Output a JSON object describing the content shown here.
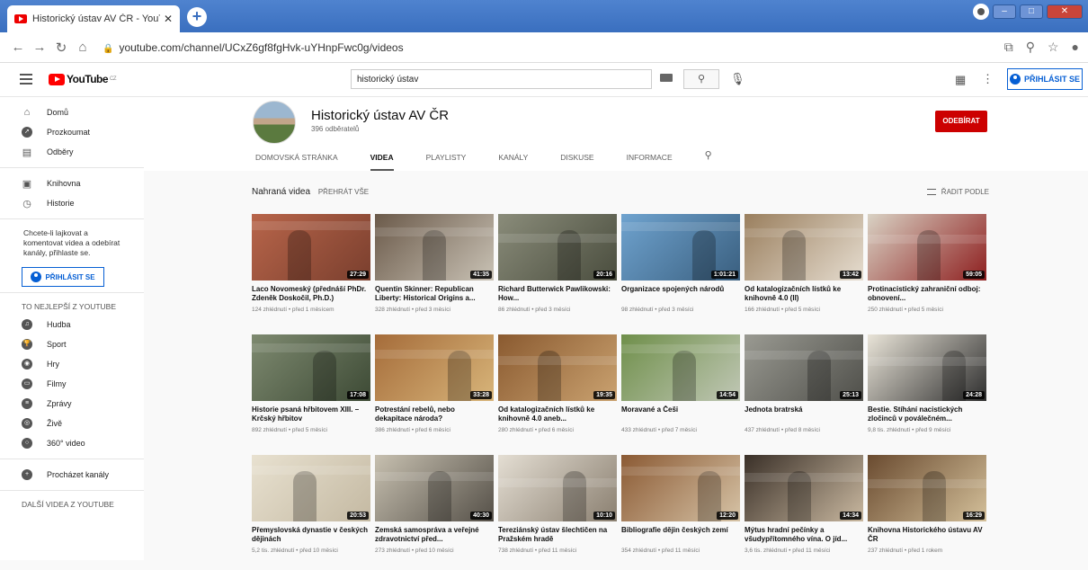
{
  "browser": {
    "tab_title": "Historický ústav AV ČR - YouTube",
    "tab_close": "✕",
    "new_tab": "+",
    "url": "youtube.com/channel/UCxZ6gf8fgHvk-uYHnpFwc0g/videos"
  },
  "header": {
    "logo_text": "YouTube",
    "logo_sup": "CZ",
    "search_value": "historický ústav",
    "signin_label": "PŘIHLÁSIT SE"
  },
  "sidebar": {
    "nav": [
      {
        "label": "Domů",
        "icon": "home-icon"
      },
      {
        "label": "Prozkoumat",
        "icon": "compass-icon"
      },
      {
        "label": "Odběry",
        "icon": "subscriptions-icon"
      }
    ],
    "library": [
      {
        "label": "Knihovna",
        "icon": "library-icon"
      },
      {
        "label": "Historie",
        "icon": "history-icon"
      }
    ],
    "signin_note": "Chcete-li lajkovat a komentovat videa a odebírat kanály, přihlaste se.",
    "signin_label": "PŘIHLÁSIT SE",
    "best_heading": "TO NEJLEPŠÍ Z YOUTUBE",
    "best": [
      {
        "label": "Hudba",
        "icon": "music-icon"
      },
      {
        "label": "Sport",
        "icon": "sport-icon"
      },
      {
        "label": "Hry",
        "icon": "gaming-icon"
      },
      {
        "label": "Filmy",
        "icon": "movies-icon"
      },
      {
        "label": "Zprávy",
        "icon": "news-icon"
      },
      {
        "label": "Živě",
        "icon": "live-icon"
      },
      {
        "label": "360° video",
        "icon": "video360-icon"
      }
    ],
    "browse_label": "Procházet kanály",
    "more_heading": "DALŠÍ VIDEA Z YOUTUBE"
  },
  "channel": {
    "name": "Historický ústav AV ČR",
    "subscribers": "396 odběratelů",
    "subscribe_label": "ODEBÍRAT",
    "tabs": [
      "DOMOVSKÁ STRÁNKA",
      "VIDEA",
      "PLAYLISTY",
      "KANÁLY",
      "DISKUSE",
      "INFORMACE"
    ],
    "active_tab": "VIDEA"
  },
  "section": {
    "title": "Nahraná videa",
    "play_all": "PŘEHRÁT VŠE",
    "sort_label": "ŘADIT PODLE"
  },
  "videos": [
    {
      "title": "Laco Novomeský (přednáší PhDr. Zdeněk Doskočil, Ph.D.)",
      "meta": "124 zhlédnutí • před 1 měsícem",
      "duration": "27:29"
    },
    {
      "title": "Quentin Skinner: Republican Liberty: Historical Origins a...",
      "meta": "328 zhlédnutí • před 3 měsíci",
      "duration": "41:35"
    },
    {
      "title": "Richard Butterwick Pawlikowski: How...",
      "meta": "86 zhlédnutí • před 3 měsíci",
      "duration": "20:16"
    },
    {
      "title": "Organizace spojených národů",
      "meta": "98 zhlédnutí • před 3 měsíci",
      "duration": "1:01:21"
    },
    {
      "title": "Od katalogizačních lístků ke knihovně 4.0 (II)",
      "meta": "166 zhlédnutí • před 5 měsíci",
      "duration": "13:42"
    },
    {
      "title": "Protinacistický zahraniční odboj: obnovení...",
      "meta": "250 zhlédnutí • před 5 měsíci",
      "duration": "59:05"
    },
    {
      "title": "Historie psaná hřbitovem XIII. – Krčský hřbitov",
      "meta": "892 zhlédnutí • před 5 měsíci",
      "duration": "17:08"
    },
    {
      "title": "Potrestání rebelů, nebo dekapitace národa?",
      "meta": "386 zhlédnutí • před 6 měsíci",
      "duration": "33:28"
    },
    {
      "title": "Od katalogizačních lístků ke knihovně 4.0 aneb...",
      "meta": "280 zhlédnutí • před 6 měsíci",
      "duration": "19:35"
    },
    {
      "title": "Moravané a Češi",
      "meta": "433 zhlédnutí • před 7 měsíci",
      "duration": "14:54"
    },
    {
      "title": "Jednota bratrská",
      "meta": "437 zhlédnutí • před 8 měsíci",
      "duration": "25:13"
    },
    {
      "title": "Bestie. Stíhání nacistických zločinců v poválečném...",
      "meta": "9,8 tis. zhlédnutí • před 9 měsíci",
      "duration": "24:28"
    },
    {
      "title": "Přemyslovská dynastie v českých dějinách",
      "meta": "5,2 tis. zhlédnutí • před 10 měsíci",
      "duration": "20:53"
    },
    {
      "title": "Zemská samospráva a veřejné zdravotnictví před...",
      "meta": "273 zhlédnutí • před 10 měsíci",
      "duration": "40:30"
    },
    {
      "title": "Tereziánský ústav šlechtičen na Pražském hradě",
      "meta": "738 zhlédnutí • před 11 měsíci",
      "duration": "10:10"
    },
    {
      "title": "Bibliografie dějin českých zemí",
      "meta": "354 zhlédnutí • před 11 měsíci",
      "duration": "12:20"
    },
    {
      "title": "Mýtus hradní pečínky a všudypřítomného vína. O jíd...",
      "meta": "3,6 tis. zhlédnutí • před 11 měsíci",
      "duration": "14:34"
    },
    {
      "title": "Knihovna Historického ústavu AV ČR",
      "meta": "237 zhlédnutí • před 1 rokem",
      "duration": "16:29"
    }
  ],
  "thumb_colors": [
    [
      "#b8654a",
      "#7a3f2e"
    ],
    [
      "#6b5a4a",
      "#c9c2b5"
    ],
    [
      "#8a8c7a",
      "#4a4d3e"
    ],
    [
      "#6fa3cf",
      "#3a5f7f"
    ],
    [
      "#9a7f5e",
      "#e6ddd0"
    ],
    [
      "#d9d2c4",
      "#8e1f1f"
    ],
    [
      "#7e8a70",
      "#3d4a35"
    ],
    [
      "#a56c3a",
      "#d8b57a"
    ],
    [
      "#8a5a30",
      "#caa270"
    ],
    [
      "#6f8f4a",
      "#c0c7b5"
    ],
    [
      "#9a9a92",
      "#4f4f4a"
    ],
    [
      "#e9e4d8",
      "#2e2e2e"
    ],
    [
      "#e8e1d0",
      "#c4b9a2"
    ],
    [
      "#c7c0b0",
      "#555048"
    ],
    [
      "#e4ded3",
      "#8a7f70"
    ],
    [
      "#8b5a34",
      "#d6c3a6"
    ],
    [
      "#3a3028",
      "#c9b8a0"
    ],
    [
      "#6a4b30",
      "#d4c09a"
    ]
  ]
}
